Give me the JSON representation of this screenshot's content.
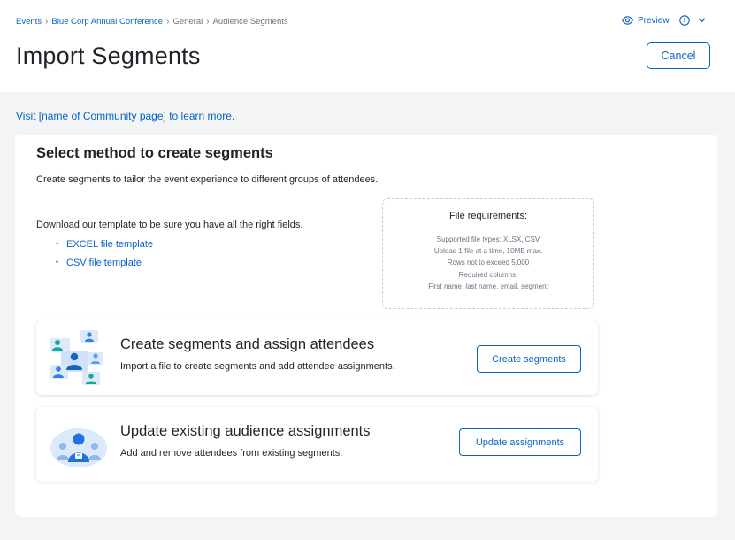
{
  "breadcrumb": {
    "items": [
      "Events",
      "Blue Corp Annual Conference",
      "General",
      "Audience Segments"
    ]
  },
  "header": {
    "title": "Import Segments",
    "preview_label": "Preview",
    "cancel_label": "Cancel"
  },
  "help_link": "Visit [name of Community page] to learn more.",
  "section": {
    "title": "Select method to create segments",
    "description": "Create segments to tailor the event experience to different groups of attendees.",
    "template_text": "Download our template to be sure you have all the right fields.",
    "templates": [
      "EXCEL file template",
      "CSV file template"
    ]
  },
  "requirements": {
    "title": "File requirements:",
    "lines": [
      "Supported file types: XLSX, CSV",
      "Upload 1 file at a time, 10MB max.",
      "Rows not to exceed 5,000",
      "Required columns:",
      "First name, last name, email, segment"
    ]
  },
  "options": [
    {
      "title": "Create segments and assign attendees",
      "description": "Import a file to create segments and add attendee assignments.",
      "button": "Create segments",
      "icon": "people-grid-illustration"
    },
    {
      "title": "Update existing audience assignments",
      "description": "Add and remove attendees from existing segments.",
      "button": "Update assignments",
      "icon": "people-group-illustration"
    }
  ],
  "colors": {
    "accent": "#0b63c4",
    "page_bg": "#f3f4f6",
    "illustration_blue": "#2f80ed",
    "illustration_light": "#dbe9fb"
  }
}
